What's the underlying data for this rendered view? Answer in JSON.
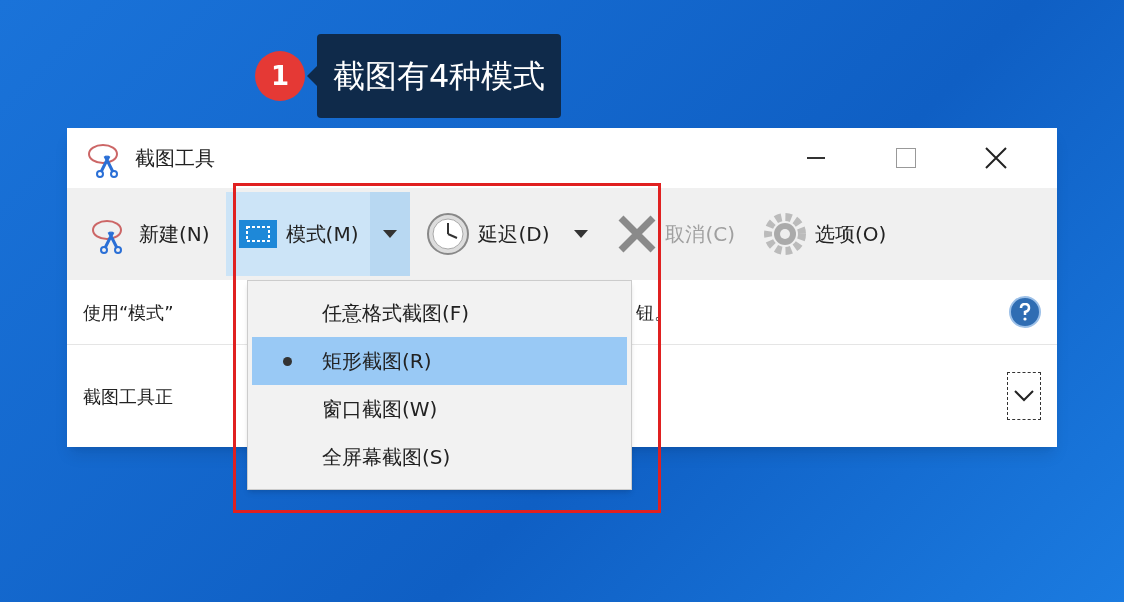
{
  "annotation": {
    "number": "1",
    "text": "截图有4种模式"
  },
  "window": {
    "title": "截图工具"
  },
  "toolbar": [
    {
      "kind": "new",
      "label": "新建(N)",
      "disabled": false,
      "pressed": false,
      "dropdown": false
    },
    {
      "kind": "mode",
      "label": "模式(M)",
      "disabled": false,
      "pressed": true,
      "dropdown": true
    },
    {
      "kind": "delay",
      "label": "延迟(D)",
      "disabled": false,
      "pressed": false,
      "dropdown": true
    },
    {
      "kind": "cancel",
      "label": "取消(C)",
      "disabled": true,
      "pressed": false,
      "dropdown": false
    },
    {
      "kind": "options",
      "label": "选项(O)",
      "disabled": false,
      "pressed": false,
      "dropdown": false
    }
  ],
  "hint_row": {
    "text_left": "使用“模式”",
    "text_right": "钮。"
  },
  "status_row": {
    "text": "截图工具正"
  },
  "mode_menu": [
    {
      "label": "任意格式截图(F)",
      "selected": false
    },
    {
      "label": "矩形截图(R)",
      "selected": true
    },
    {
      "label": "窗口截图(W)",
      "selected": false
    },
    {
      "label": "全屏幕截图(S)",
      "selected": false
    }
  ]
}
